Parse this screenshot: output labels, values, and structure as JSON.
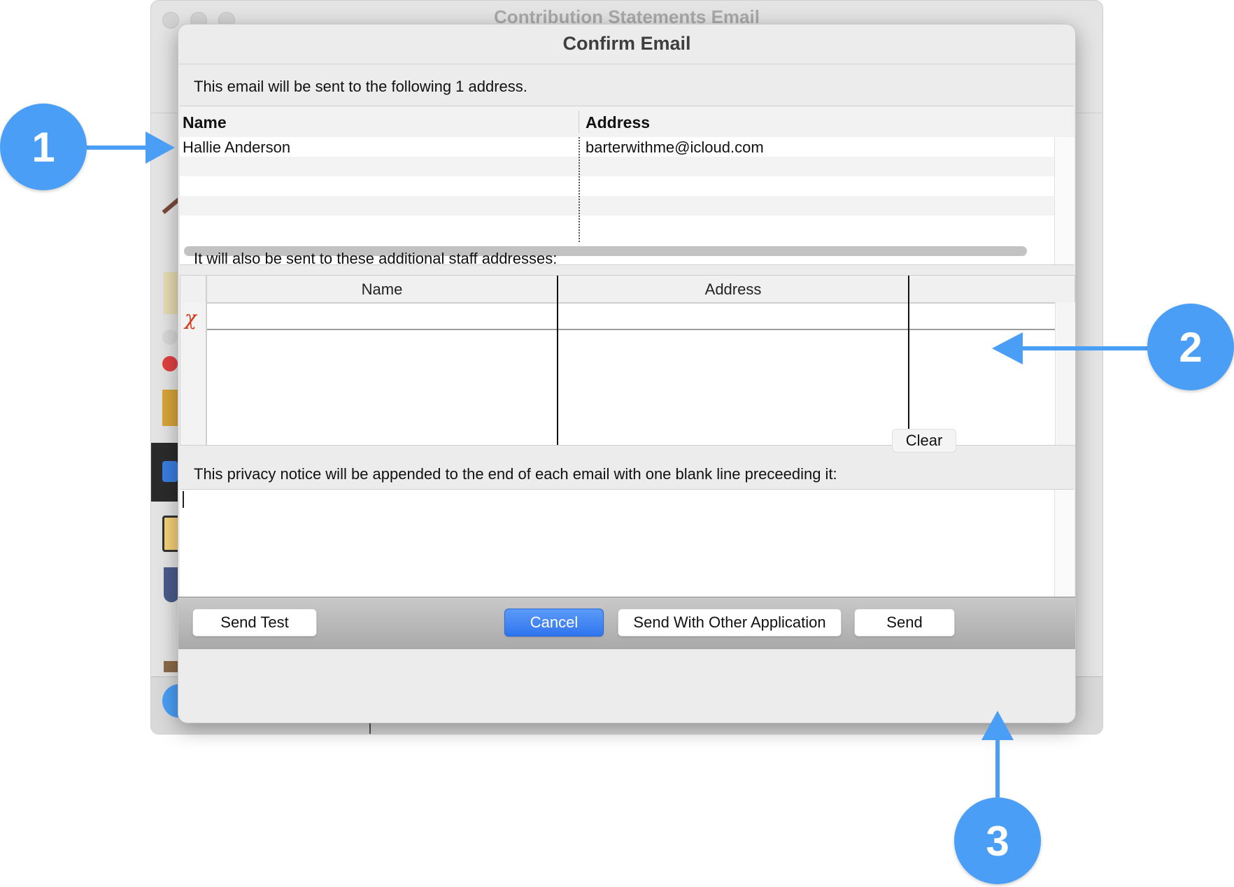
{
  "parent_window": {
    "title": "Contribution Statements Email"
  },
  "dialog": {
    "title": "Confirm Email",
    "recipients_label": "This email will be sent to the following 1 address.",
    "recipients_table": {
      "columns": [
        "Name",
        "Address"
      ],
      "rows": [
        {
          "name": "Hallie Anderson",
          "address": "barterwithme@icloud.com"
        }
      ]
    },
    "staff_label": "It will also be sent to these additional staff addresses:",
    "staff_table": {
      "columns": [
        "Name",
        "Address"
      ],
      "rows": [
        {
          "name": "",
          "address": ""
        }
      ]
    },
    "clear_button": "Clear",
    "privacy_label": "This privacy notice will be appended to the end of each email with one blank line preceeding it:",
    "privacy_text": "",
    "footer": {
      "send_test": "Send Test",
      "cancel": "Cancel",
      "send_other": "Send With Other Application",
      "send": "Send"
    }
  },
  "annotations": [
    {
      "label": "1"
    },
    {
      "label": "2"
    },
    {
      "label": "3"
    }
  ],
  "colors": {
    "accent": "#4a9ef5",
    "primary_button": "#3b82f6",
    "delete_icon": "#d23a1a"
  },
  "icons": [
    "delete-row-icon"
  ]
}
